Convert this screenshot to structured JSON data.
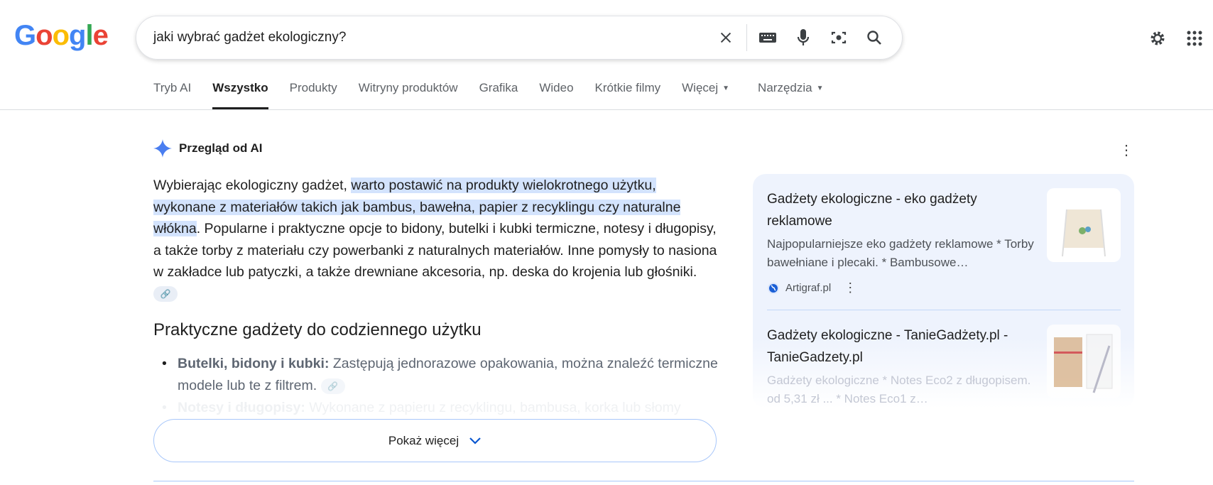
{
  "logo": "Google",
  "search": {
    "query": "jaki wybrać gadżet ekologiczny?"
  },
  "tabs": [
    {
      "label": "Tryb AI",
      "active": false
    },
    {
      "label": "Wszystko",
      "active": true
    },
    {
      "label": "Produkty",
      "active": false
    },
    {
      "label": "Witryny produktów",
      "active": false
    },
    {
      "label": "Grafika",
      "active": false
    },
    {
      "label": "Wideo",
      "active": false
    },
    {
      "label": "Krótkie filmy",
      "active": false
    },
    {
      "label": "Więcej",
      "active": false
    },
    {
      "label": "Narzędzia",
      "active": false
    }
  ],
  "ai": {
    "title": "Przegląd od AI",
    "intro_before": "Wybierając ekologiczny gadżet, ",
    "intro_highlight": "warto postawić na produkty wielokrotnego użytku, wykonane z materiałów takich jak bambus, bawełna, papier z recyklingu czy naturalne włókna",
    "intro_after": ". Popularne i praktyczne opcje to bidony, butelki i kubki termiczne, notesy i długopisy, a także torby z materiału czy powerbanki z naturalnych materiałów. Inne pomysły to nasiona w zakładce lub patyczki, a także drewniane akcesoria, np. deska do krojenia lub głośniki.",
    "heading": "Praktyczne gadżety do codziennego użytku",
    "bullets": [
      {
        "bold": "Butelki, bidony i kubki:",
        "text": " Zastępują jednorazowe opakowania, można znaleźć termiczne modele lub te z filtrem."
      },
      {
        "bold": "Notesy i długopisy:",
        "text": " Wykonane z papieru z recyklingu, bambusa, korka lub słomy"
      }
    ],
    "show_more": "Pokaż więcej"
  },
  "sources": [
    {
      "title": "Gadżety ekologiczne - eko gadżety reklamowe",
      "snippet": "Najpopularniejsze eko gadżety reklamowe * Torby bawełniane i plecaki. * Bambusowe…",
      "site": "Artigraf.pl"
    },
    {
      "title": "Gadżety ekologiczne - TanieGadżety.pl - TanieGadzety.pl",
      "snippet": "Gadżety ekologiczne * Notes Eco2 z długopisem. od 5,31 zł ... * Notes Eco1 z…"
    }
  ],
  "colors": {
    "accent": "#0b57d0",
    "highlight": "#d3e3fd",
    "card_bg": "#eef3fd"
  }
}
